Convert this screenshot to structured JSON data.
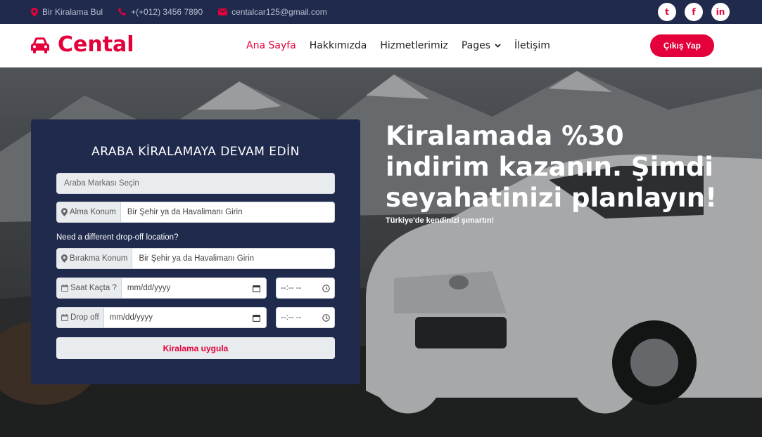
{
  "topbar": {
    "location": "Bir Kiralama Bul",
    "phone": "+(+012) 3456 7890",
    "email": "centalcar125@gmail.com",
    "socials": [
      {
        "name": "twitter",
        "glyph": "t"
      },
      {
        "name": "facebook",
        "glyph": "f"
      },
      {
        "name": "linkedin",
        "glyph": "in"
      }
    ]
  },
  "brand": {
    "name": "Cental"
  },
  "nav": {
    "items": [
      "Ana Sayfa",
      "Hakkımızda",
      "Hizmetlerimiz",
      "Pages",
      "İletişim"
    ],
    "active": "Ana Sayfa",
    "logout": "Çıkış Yap"
  },
  "booking": {
    "title": "ARABA KİRALAMAYA DEVAM EDİN",
    "brand_select": "Araba Markası Seçin",
    "pickup_label": "Alma Konum",
    "pickup_placeholder": "Bir Şehir ya da Havalimanı Girin",
    "dropoff_question": "Need a different drop-off location?",
    "dropoff_label": "Bırakma Konum",
    "dropoff_placeholder": "Bir Şehir ya da Havalimanı Girin",
    "pickup_time_label": "Saat Kaçta ?",
    "date_placeholder": "mm/dd/yyyy",
    "time_placeholder": "--:-- --",
    "dropoff_time_label": "Drop off",
    "submit": "Kiralama uygula"
  },
  "hero": {
    "headline": "Kiralamada %30 indirim kazanın. Şimdi seyahatinizi planlayın!",
    "subtitle": "Türkiye'de kendinizi şımartın!"
  },
  "colors": {
    "accent": "#e4003a",
    "navy": "#1f2a4d"
  }
}
